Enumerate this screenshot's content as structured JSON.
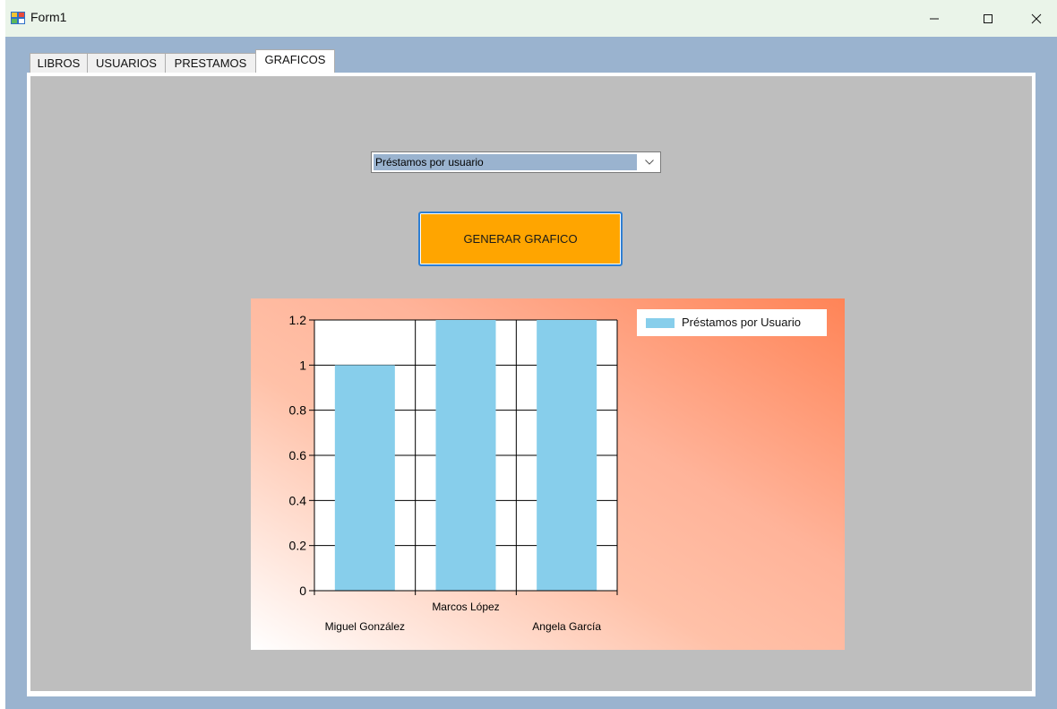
{
  "window": {
    "title": "Form1"
  },
  "tabs": [
    {
      "label": "LIBROS"
    },
    {
      "label": "USUARIOS"
    },
    {
      "label": "PRESTAMOS"
    },
    {
      "label": "GRAFICOS"
    }
  ],
  "graficos": {
    "combo": {
      "selected": "Préstamos por usuario"
    },
    "generate_button": "GENERAR GRAFICO"
  },
  "colors": {
    "bar": "#87ceeb",
    "button": "#ffa500",
    "selection": "#9ab3cf"
  },
  "chart_data": {
    "type": "bar",
    "categories": [
      "Miguel González",
      "Marcos López",
      "Angela García"
    ],
    "series": [
      {
        "name": "Préstamos por Usuario",
        "values": [
          1,
          1.2,
          1.2
        ]
      }
    ],
    "ylim": [
      0,
      1.2
    ],
    "yticks": [
      "0",
      "0.2",
      "0.4",
      "0.6",
      "0.8",
      "1",
      "1.2"
    ],
    "grid": true,
    "legend": "top-right"
  }
}
